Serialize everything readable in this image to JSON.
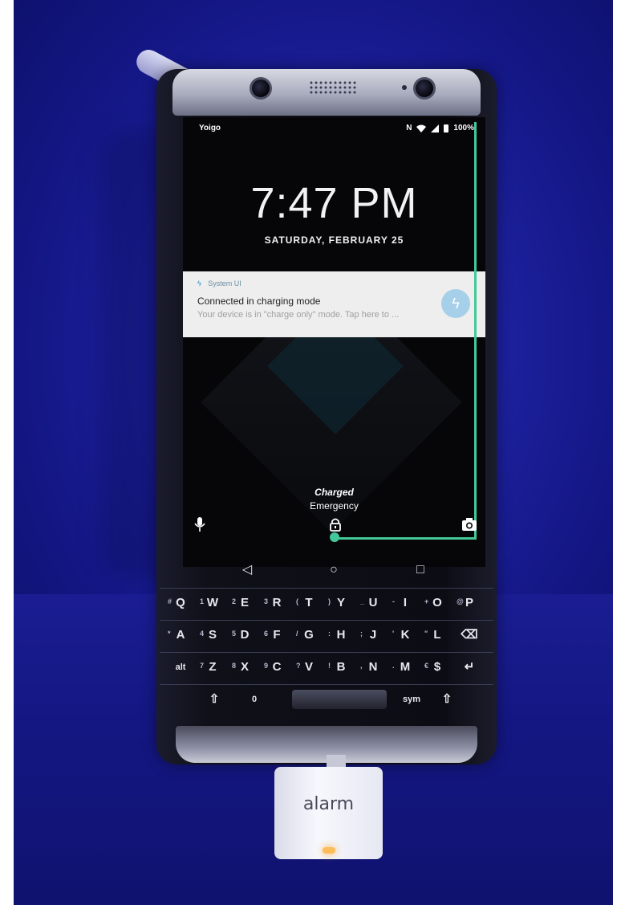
{
  "status_bar": {
    "carrier": "Yoigo",
    "network_letter": "N",
    "battery": "100%"
  },
  "lock_screen": {
    "time": "7:47 PM",
    "date": "SATURDAY, FEBRUARY 25",
    "charged": "Charged",
    "emergency": "Emergency"
  },
  "notification": {
    "app_name": "System UI",
    "title": "Connected in charging mode",
    "text": "Your device is in \"charge only\" mode. Tap here to ..."
  },
  "navbar": {
    "back": "◁",
    "home": "○",
    "recents": "□"
  },
  "keyboard": {
    "row1": [
      {
        "alt": "#",
        "key": "Q"
      },
      {
        "alt": "1",
        "key": "W"
      },
      {
        "alt": "2",
        "key": "E"
      },
      {
        "alt": "3",
        "key": "R"
      },
      {
        "alt": "(",
        "key": "T"
      },
      {
        "alt": ")",
        "key": "Y"
      },
      {
        "alt": "_",
        "key": "U"
      },
      {
        "alt": "-",
        "key": "I"
      },
      {
        "alt": "+",
        "key": "O"
      },
      {
        "alt": "@",
        "key": "P"
      }
    ],
    "row2": [
      {
        "alt": "*",
        "key": "A"
      },
      {
        "alt": "4",
        "key": "S"
      },
      {
        "alt": "5",
        "key": "D"
      },
      {
        "alt": "6",
        "key": "F"
      },
      {
        "alt": "/",
        "key": "G"
      },
      {
        "alt": ":",
        "key": "H"
      },
      {
        "alt": ";",
        "key": "J"
      },
      {
        "alt": "'",
        "key": "K"
      },
      {
        "alt": "\"",
        "key": "L"
      },
      {
        "alt": "",
        "key": "⌫"
      }
    ],
    "row3": [
      {
        "alt": "",
        "key": "alt"
      },
      {
        "alt": "7",
        "key": "Z"
      },
      {
        "alt": "8",
        "key": "X"
      },
      {
        "alt": "9",
        "key": "C"
      },
      {
        "alt": "?",
        "key": "V"
      },
      {
        "alt": "!",
        "key": "B"
      },
      {
        "alt": ",",
        "key": "N"
      },
      {
        "alt": ".",
        "key": "M"
      },
      {
        "alt": "€",
        "key": "$"
      },
      {
        "alt": "",
        "key": "↵"
      }
    ],
    "row4": {
      "shift_left": "⇧",
      "zero": "0",
      "sym": "sym",
      "shift_right": "⇧"
    }
  },
  "accessory": {
    "label": "alarm"
  },
  "colors": {
    "background_blue": "#1e22a0",
    "charge_line": "#43c999",
    "notification_bg": "#eeeeee"
  },
  "icons": [
    "mic-icon",
    "lock-icon",
    "camera-icon",
    "wifi-icon",
    "signal-icon",
    "battery-icon",
    "bolt-icon"
  ]
}
